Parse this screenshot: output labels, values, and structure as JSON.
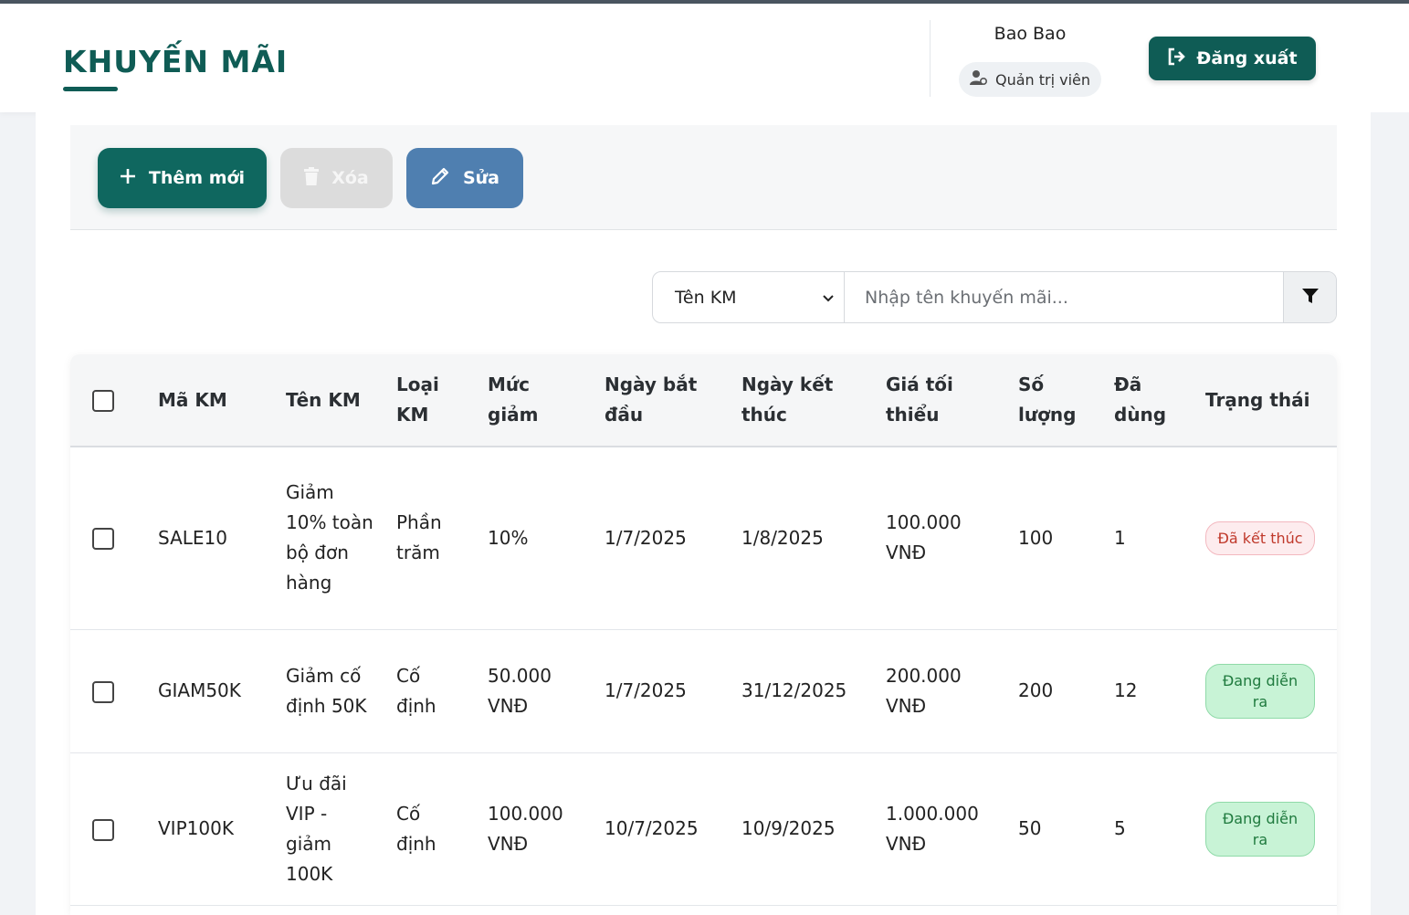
{
  "header": {
    "title": "KHUYẾN MÃI",
    "user_name": "Bao Bao",
    "role": "Quản trị viên",
    "logout_label": "Đăng xuất"
  },
  "toolbar": {
    "add_label": "Thêm mới",
    "delete_label": "Xóa",
    "edit_label": "Sửa"
  },
  "filter": {
    "selected_field": "Tên KM",
    "search_placeholder": "Nhập tên khuyến mãi..."
  },
  "table": {
    "columns": [
      "Mã KM",
      "Tên KM",
      "Loại KM",
      "Mức giảm",
      "Ngày bắt đầu",
      "Ngày kết thúc",
      "Giá tối thiểu",
      "Số lượng",
      "Đã dùng",
      "Trạng thái"
    ],
    "rows": [
      {
        "code": "SALE10",
        "name": "Giảm 10% toàn bộ đơn hàng",
        "type": "Phần trăm",
        "discount": "10%",
        "start": "1/7/2025",
        "end": "1/8/2025",
        "min_price": "100.000 VNĐ",
        "quantity": "100",
        "used": "1",
        "status": "Đã kết thúc"
      },
      {
        "code": "GIAM50K",
        "name": "Giảm cố định 50K",
        "type": "Cố định",
        "discount": "50.000 VNĐ",
        "start": "1/7/2025",
        "end": "31/12/2025",
        "min_price": "200.000 VNĐ",
        "quantity": "200",
        "used": "12",
        "status": "Đang diễn ra"
      },
      {
        "code": "VIP100K",
        "name": "Ưu đãi VIP - giảm 100K",
        "type": "Cố định",
        "discount": "100.000 VNĐ",
        "start": "10/7/2025",
        "end": "10/9/2025",
        "min_price": "1.000.000 VNĐ",
        "quantity": "50",
        "used": "5",
        "status": "Đang diễn ra"
      }
    ]
  },
  "colors": {
    "brand": "#0f5c55",
    "edit": "#4f7fb0",
    "status_ended": "#c0392b",
    "status_active": "#1f7a3e"
  }
}
